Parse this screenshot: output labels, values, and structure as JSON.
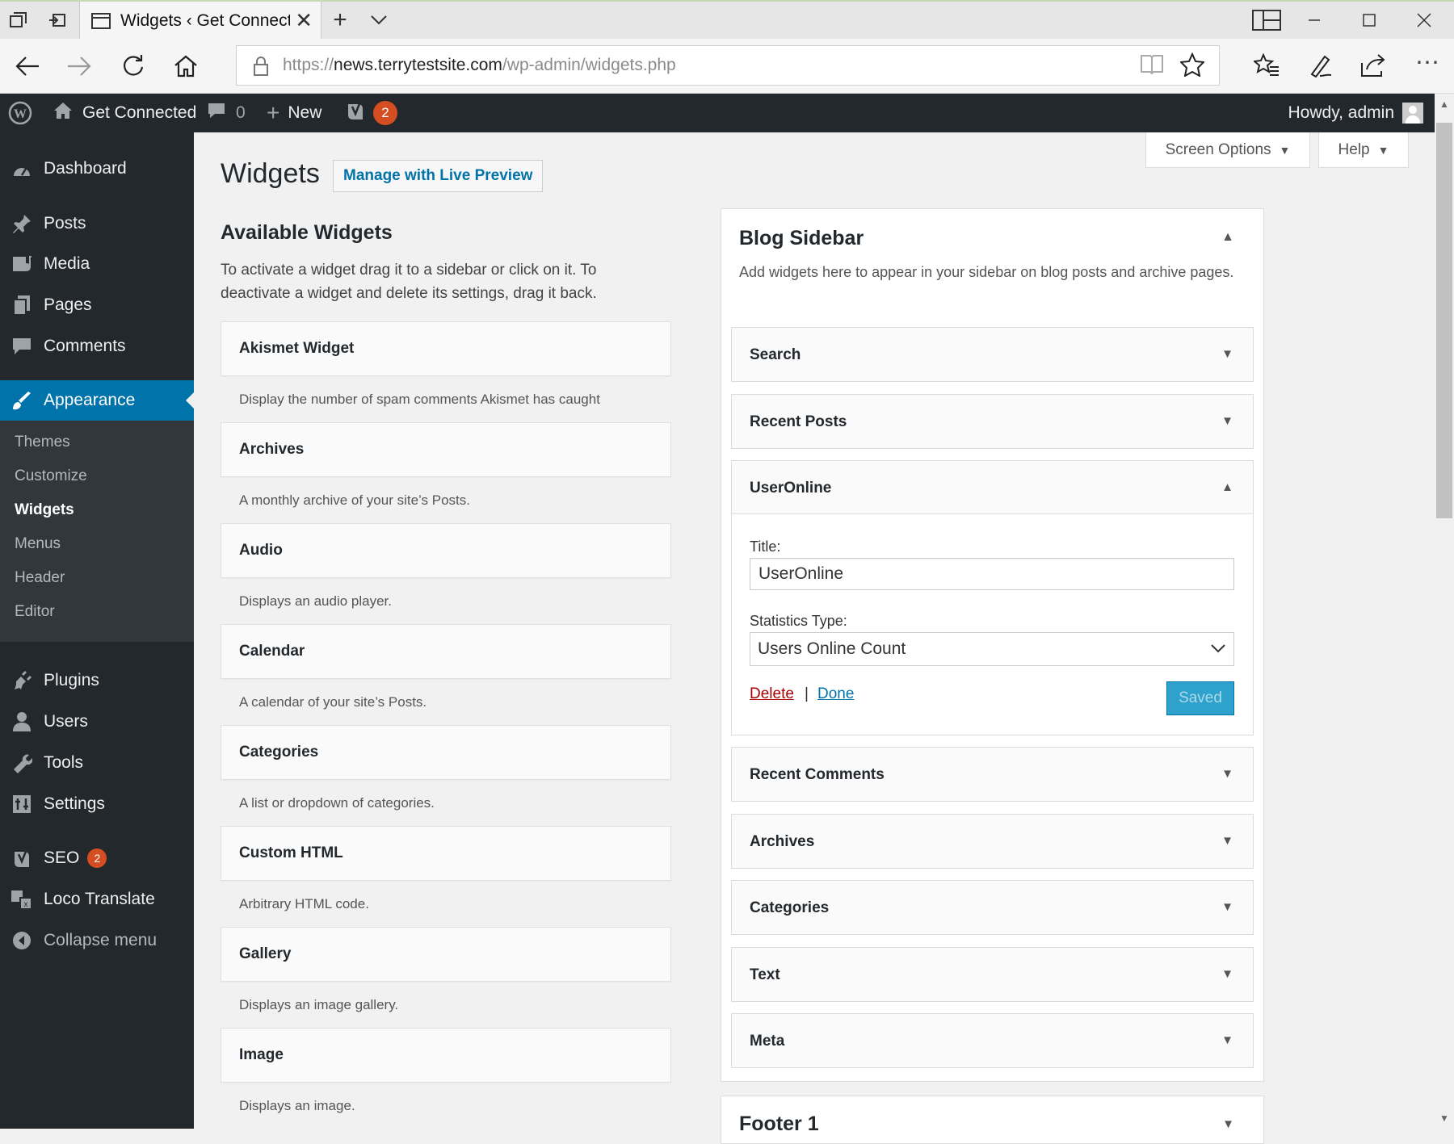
{
  "browser": {
    "tab_title": "Widgets ‹ Get Connected",
    "url_prefix": "https://",
    "url_host": "news.terrytestsite.com",
    "url_path": "/wp-admin/widgets.php",
    "icons": [
      "tab-manager-icon",
      "set-aside-icon",
      "page-icon",
      "close-icon",
      "plus-icon",
      "chevron-down-icon",
      "layout-icon",
      "minimize-icon",
      "maximize-icon",
      "close-window-icon",
      "back-icon",
      "forward-icon",
      "refresh-icon",
      "home-icon",
      "lock-icon",
      "reading-view-icon",
      "star-icon",
      "favorites-icon",
      "pen-icon",
      "share-icon",
      "more-icon"
    ]
  },
  "adminbar": {
    "site_name": "Get Connected",
    "comments_count": "0",
    "new_label": "New",
    "yoast_badge": "2",
    "howdy": "Howdy, admin"
  },
  "sidebar": {
    "items": [
      {
        "label": "Dashboard",
        "icon": "dashboard-icon"
      },
      {
        "label": "Posts",
        "icon": "pin-icon"
      },
      {
        "label": "Media",
        "icon": "media-icon"
      },
      {
        "label": "Pages",
        "icon": "pages-icon"
      },
      {
        "label": "Comments",
        "icon": "comment-icon"
      },
      {
        "label": "Appearance",
        "icon": "brush-icon"
      },
      {
        "label": "Plugins",
        "icon": "plugin-icon"
      },
      {
        "label": "Users",
        "icon": "user-icon"
      },
      {
        "label": "Tools",
        "icon": "wrench-icon"
      },
      {
        "label": "Settings",
        "icon": "settings-icon"
      },
      {
        "label": "SEO",
        "icon": "yoast-icon",
        "badge": "2"
      },
      {
        "label": "Loco Translate",
        "icon": "translate-icon"
      },
      {
        "label": "Collapse menu",
        "icon": "collapse-icon"
      }
    ],
    "submenu": [
      "Themes",
      "Customize",
      "Widgets",
      "Menus",
      "Header",
      "Editor"
    ]
  },
  "header": {
    "screen_options": "Screen Options",
    "help": "Help",
    "title": "Widgets",
    "live_preview": "Manage with Live Preview"
  },
  "available": {
    "heading": "Available Widgets",
    "description": "To activate a widget drag it to a sidebar or click on it. To deactivate a widget and delete its settings, drag it back.",
    "widgets": [
      {
        "name": "Akismet Widget",
        "desc": "Display the number of spam comments Akismet has caught"
      },
      {
        "name": "Archives",
        "desc": "A monthly archive of your site’s Posts."
      },
      {
        "name": "Audio",
        "desc": "Displays an audio player."
      },
      {
        "name": "Calendar",
        "desc": "A calendar of your site’s Posts."
      },
      {
        "name": "Categories",
        "desc": "A list or dropdown of categories."
      },
      {
        "name": "Custom HTML",
        "desc": "Arbitrary HTML code."
      },
      {
        "name": "Gallery",
        "desc": "Displays an image gallery."
      },
      {
        "name": "Image",
        "desc": "Displays an image."
      }
    ]
  },
  "blog_sidebar": {
    "title": "Blog Sidebar",
    "description": "Add widgets here to appear in your sidebar on blog posts and archive pages.",
    "widgets": [
      "Search",
      "Recent Posts",
      "UserOnline",
      "Recent Comments",
      "Archives",
      "Categories",
      "Text",
      "Meta"
    ],
    "open_widget": {
      "title_label": "Title:",
      "title_value": "UserOnline",
      "stat_label": "Statistics Type:",
      "stat_value": "Users Online Count",
      "delete": "Delete",
      "separator": "|",
      "done": "Done",
      "saved": "Saved"
    }
  },
  "footer1": {
    "title": "Footer 1"
  },
  "colors": {
    "admin_dark": "#23282d",
    "accent": "#0073aa",
    "badge": "#d54e21",
    "saved": "#2ea2cc",
    "delete": "#a00"
  }
}
